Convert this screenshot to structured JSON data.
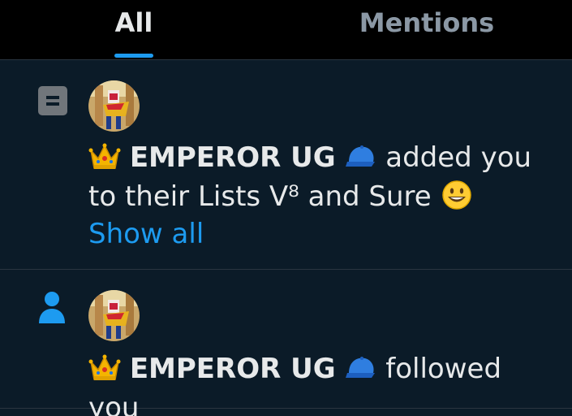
{
  "tabs": {
    "all_label": "All",
    "mentions_label": "Mentions",
    "active": "All"
  },
  "notifications": [
    {
      "type_icon": "list-icon",
      "avatar": "avatar",
      "name": "EMPEROR UG",
      "name_prefix_emoji": "crown",
      "name_suffix_emoji": "blue-cap",
      "action": "added you to their Lists V⁸ and Sure",
      "trailing_emoji": "smiley",
      "link": "Show all"
    },
    {
      "type_icon": "person-icon",
      "avatar": "avatar",
      "name": "EMPEROR UG",
      "name_prefix_emoji": "crown",
      "name_suffix_emoji": "blue-cap",
      "action": "followed you"
    }
  ],
  "colors": {
    "background": "#0b1b28",
    "header": "#000000",
    "accent": "#1d9bf0",
    "text": "#e7e9ea",
    "muted": "#8b98a5"
  }
}
